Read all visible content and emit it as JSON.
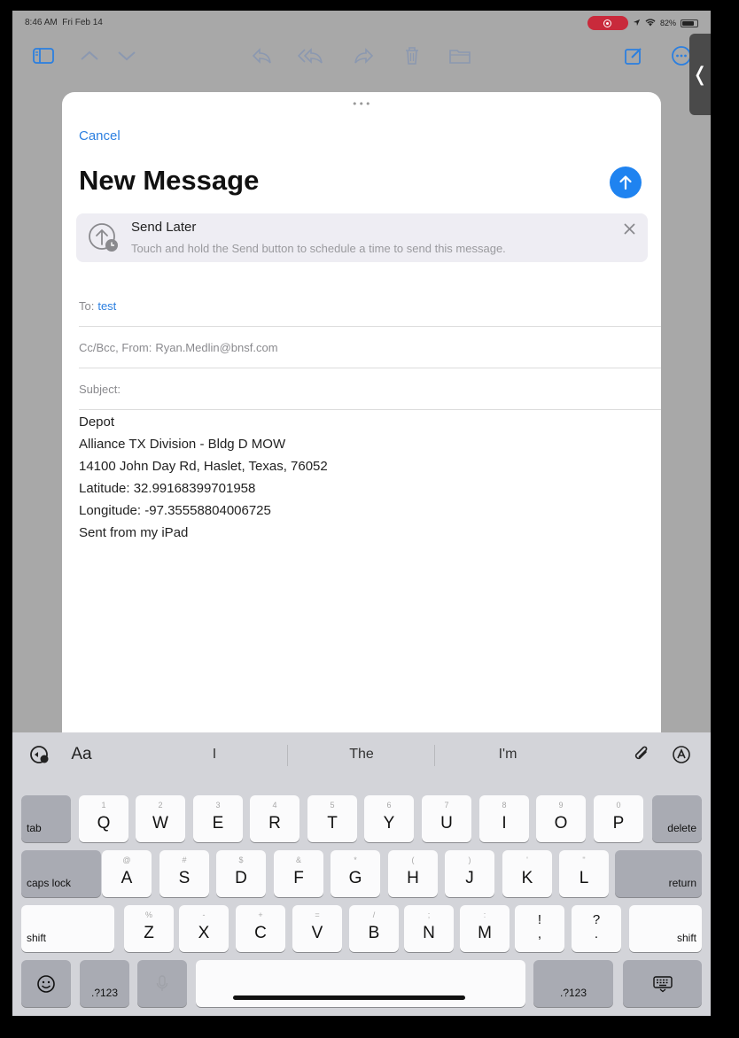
{
  "status_bar": {
    "time": "8:46 AM",
    "date": "Fri Feb 14",
    "battery": "82%"
  },
  "compose": {
    "cancel_label": "Cancel",
    "title": "New Message",
    "send_later": {
      "title": "Send Later",
      "text": "Touch and hold the Send button to schedule a time to send this message."
    },
    "to_label": "To:",
    "to_value": "test",
    "cc_label": "Cc/Bcc, From:",
    "from_value": "Ryan.Medlin@bnsf.com",
    "subject_label": "Subject:",
    "body_lines": [
      "Depot",
      "Alliance TX Division - Bldg D MOW",
      "14100 John Day Rd, Haslet, Texas, 76052",
      "Latitude: 32.99168399701958",
      "Longitude: -97.35558804006725",
      "Sent from my iPad"
    ]
  },
  "keyboard": {
    "format_label": "Aa",
    "suggestions": [
      "I",
      "The",
      "I'm"
    ],
    "row1": [
      {
        "main": "Q",
        "hint": "1"
      },
      {
        "main": "W",
        "hint": "2"
      },
      {
        "main": "E",
        "hint": "3"
      },
      {
        "main": "R",
        "hint": "4"
      },
      {
        "main": "T",
        "hint": "5"
      },
      {
        "main": "Y",
        "hint": "6"
      },
      {
        "main": "U",
        "hint": "7"
      },
      {
        "main": "I",
        "hint": "8"
      },
      {
        "main": "O",
        "hint": "9"
      },
      {
        "main": "P",
        "hint": "0"
      }
    ],
    "row2": [
      {
        "main": "A",
        "hint": "@"
      },
      {
        "main": "S",
        "hint": "#"
      },
      {
        "main": "D",
        "hint": "$"
      },
      {
        "main": "F",
        "hint": "&"
      },
      {
        "main": "G",
        "hint": "*"
      },
      {
        "main": "H",
        "hint": "("
      },
      {
        "main": "J",
        "hint": ")"
      },
      {
        "main": "K",
        "hint": "'"
      },
      {
        "main": "L",
        "hint": "\""
      }
    ],
    "row3": [
      {
        "main": "Z",
        "hint": "%"
      },
      {
        "main": "X",
        "hint": "-"
      },
      {
        "main": "C",
        "hint": "+"
      },
      {
        "main": "V",
        "hint": "="
      },
      {
        "main": "B",
        "hint": "/"
      },
      {
        "main": "N",
        "hint": ";"
      },
      {
        "main": "M",
        "hint": ":"
      }
    ],
    "punct": [
      {
        "top": "!",
        "bottom": ","
      },
      {
        "top": "?",
        "bottom": "."
      }
    ],
    "tab": "tab",
    "delete": "delete",
    "caps_lock": "caps lock",
    "return": "return",
    "shift": "shift",
    "numbers": ".?123"
  },
  "colors": {
    "accent": "#2b7fe0",
    "send": "#1f83f0",
    "record": "#c92a3b"
  }
}
